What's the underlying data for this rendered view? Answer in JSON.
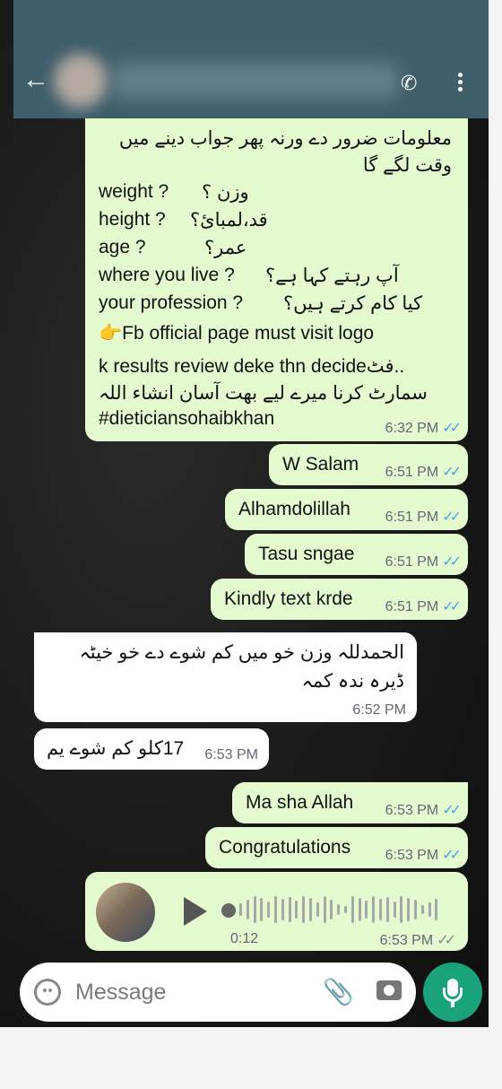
{
  "header": {
    "back_icon": "arrow-left-icon",
    "call_icon": "phone-icon",
    "menu_icon": "more-vert-icon"
  },
  "messages": {
    "long": {
      "line1": "معلومات ضرور دے ورنہ پھر جواب دینے میں",
      "line2": "وقت لگے گا",
      "weight_en": "weight ?",
      "weight_ur": "وزن ؟",
      "height_en": "height ?",
      "height_ur": "قد،لمبائ؟",
      "age_en": "age  ?",
      "age_ur": "عمر؟",
      "live_en": "where you live ?",
      "live_ur": "آپ رہتے کہا ہے؟",
      "prof_en": "your profession ?",
      "prof_ur": "کیا کام کرتے ہیں؟",
      "fb": "👉Fb official page must visit logo",
      "results": "k results review deke thn decideفٹ..",
      "smart": "سمارٹ کرنا میرے لیے بھت آسان انشاء اللہ",
      "tag": "#dieticiansohaibkhan",
      "time": "6:32 PM"
    },
    "w_salam": {
      "text": "W Salam",
      "time": "6:51 PM"
    },
    "alhamdolillah": {
      "text": "Alhamdolillah",
      "time": "6:51 PM"
    },
    "tasu": {
      "text": "Tasu sngae",
      "time": "6:51 PM"
    },
    "kindly": {
      "text": "Kindly text krde",
      "time": "6:51 PM"
    },
    "in1": {
      "line1": "الحمدللہ وزن خو میں کم شوے دے خو خیٹہ",
      "line2": "ڈیرہ ندہ کمہ",
      "time": "6:52 PM"
    },
    "in2": {
      "text": "17کلو کم شوے یم",
      "time": "6:53 PM"
    },
    "mashallah": {
      "text": "Ma sha Allah",
      "time": "6:53 PM"
    },
    "congrats": {
      "text": "Congratulations",
      "time": "6:53 PM"
    },
    "voice": {
      "duration": "0:12",
      "time": "6:53 PM",
      "progress": 0
    }
  },
  "composer": {
    "placeholder": "Message",
    "emoji_icon": "emoji-icon",
    "attach_icon": "paperclip-icon",
    "camera_icon": "camera-icon",
    "mic_icon": "mic-icon"
  },
  "colors": {
    "header": "#3e5e6a",
    "outgoing": "#e4fbd0",
    "incoming": "#ffffff",
    "read_ticks": "#4fa3e0",
    "mic_button": "#1aa37a"
  }
}
